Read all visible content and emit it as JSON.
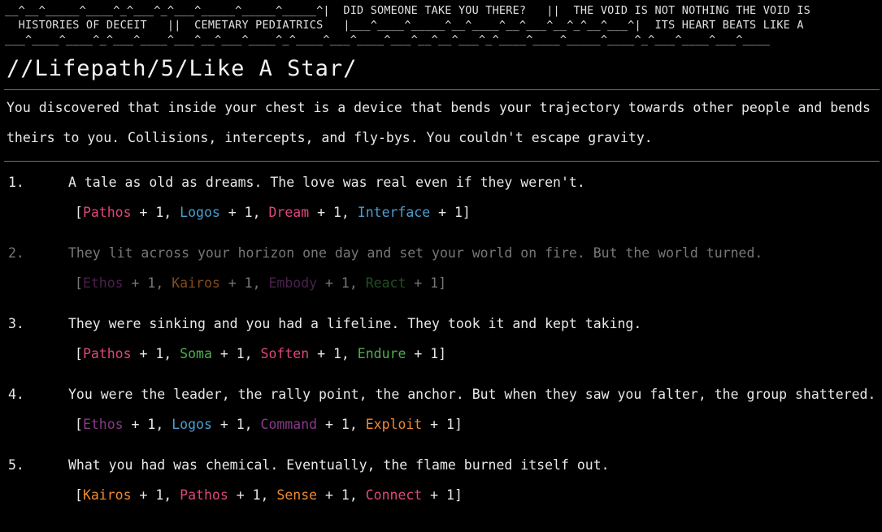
{
  "marquee": {
    "line1": "__^__^_____^____^_^___^_^___^_____^_____^_____^|  DID SOMEONE TAKE YOU THERE?   ||  THE VOID IS NOT NOTHING THE VOID IS",
    "line2": "  HISTORIES OF DECEIT   ||  CEMETARY PEDIATRICS   |___^____^_____^__^____^__^___^__^_^__^___^|  ITS HEART BEATS LIKE A",
    "line3": "___^____^____^_^___^____^___^__^___^____^_^____^___^____^___^__^__^___^_^____^____^_____^____^_^___^____^___^____"
  },
  "page_title": "//Lifepath/5/Like A Star/",
  "description": "You discovered that inside your chest is a device that bends your trajectory towards other people and bends theirs to you. Collisions, intercepts, and fly-bys. You couldn't escape gravity.",
  "colors": {
    "background": "#000000",
    "text": "#e8e8e8",
    "dim_text": "#777777",
    "rule": "#6e6e8a",
    "Pathos": "#e0457e",
    "Logos": "#4a9fd0",
    "Dream": "#e0457e",
    "Interface": "#4a9fd0",
    "Ethos": "#8a3a8a",
    "Kairos": "#f08a30",
    "Embody": "#8a3a8a",
    "React": "#3f8f3f",
    "Soma": "#4caf50",
    "Soften": "#e0457e",
    "Endure": "#4caf50",
    "Command": "#8a3a8a",
    "Exploit": "#f08a30",
    "Sense": "#f08a30",
    "Connect": "#e0457e"
  },
  "options": [
    {
      "number": "1.",
      "text": "A tale as old as dreams. The love was real even if they weren't.",
      "dim": false,
      "stats": [
        {
          "name": "Pathos",
          "bonus": "+ 1"
        },
        {
          "name": "Logos",
          "bonus": "+ 1"
        },
        {
          "name": "Dream",
          "bonus": "+ 1"
        },
        {
          "name": "Interface",
          "bonus": "+ 1"
        }
      ]
    },
    {
      "number": "2.",
      "text": "They lit across your horizon one day and set your world on fire. But the world turned.",
      "dim": true,
      "stats": [
        {
          "name": "Ethos",
          "bonus": "+ 1"
        },
        {
          "name": "Kairos",
          "bonus": "+ 1"
        },
        {
          "name": "Embody",
          "bonus": "+ 1"
        },
        {
          "name": "React",
          "bonus": "+ 1"
        }
      ]
    },
    {
      "number": "3.",
      "text": "They were sinking and you had a lifeline. They took it and kept taking.",
      "dim": false,
      "stats": [
        {
          "name": "Pathos",
          "bonus": "+ 1"
        },
        {
          "name": "Soma",
          "bonus": "+ 1"
        },
        {
          "name": "Soften",
          "bonus": "+ 1"
        },
        {
          "name": "Endure",
          "bonus": "+ 1"
        }
      ]
    },
    {
      "number": "4.",
      "text": "You were the leader, the rally point, the anchor. But when they saw you falter, the group shattered.",
      "dim": false,
      "stats": [
        {
          "name": "Ethos",
          "bonus": "+ 1"
        },
        {
          "name": "Logos",
          "bonus": "+ 1"
        },
        {
          "name": "Command",
          "bonus": "+ 1"
        },
        {
          "name": "Exploit",
          "bonus": "+ 1"
        }
      ]
    },
    {
      "number": "5.",
      "text": "What you had was chemical. Eventually, the flame burned itself out.",
      "dim": false,
      "stats": [
        {
          "name": "Kairos",
          "bonus": "+ 1"
        },
        {
          "name": "Pathos",
          "bonus": "+ 1"
        },
        {
          "name": "Sense",
          "bonus": "+ 1"
        },
        {
          "name": "Connect",
          "bonus": "+ 1"
        }
      ]
    }
  ]
}
